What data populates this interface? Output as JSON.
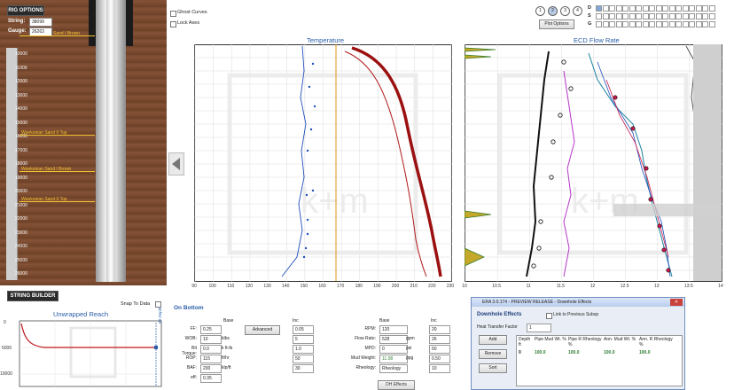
{
  "wellbore": {
    "rig_options": "RIG OPTIONS",
    "string_label": "String:",
    "string_value": "38099",
    "gauge_label": "Gauge:",
    "gauge_value": "26263",
    "depth_labels": [
      "10000",
      "11000",
      "12000",
      "13000",
      "14000",
      "15000",
      "16000",
      "17000",
      "18000",
      "19000",
      "20000",
      "21000",
      "22000",
      "23000",
      "24000",
      "25000",
      "26000"
    ],
    "formations": [
      "Sand I Brown",
      "Weekonian Sand II Top",
      "Weekonian Sand I Brown",
      "Weekonian Sand II Top"
    ],
    "string_builder": "STRING BUILDER",
    "snap_to_data": "Snap To Data"
  },
  "options": {
    "ghost_curves": "Ghost Curves",
    "lock_axes": "Lock Axes",
    "plot_numbers": [
      "1",
      "2",
      "3",
      "4"
    ],
    "plot_options": "Plot Options",
    "dsg": [
      "D",
      "S",
      "G"
    ]
  },
  "temperature_plot": {
    "title": "Temperature",
    "x_ticks": [
      "90",
      "100",
      "110",
      "120",
      "130",
      "140",
      "150",
      "160",
      "170",
      "180",
      "190",
      "200",
      "210",
      "220",
      "230"
    ],
    "watermark": "k+m"
  },
  "ecd_plot": {
    "title": "ECD Flow Rate",
    "x_ticks": [
      "10",
      "10.5",
      "11",
      "11.5",
      "12",
      "12.5",
      "13",
      "13.5",
      "14"
    ],
    "watermark": "k+m"
  },
  "reach": {
    "title": "Unwrapped Reach",
    "y_ticks": [
      "0",
      "5000",
      "10000"
    ],
    "bit_depth": "Bit Depth",
    "watermark": "k+m"
  },
  "on_bottom": {
    "title": "On Bottom",
    "base_label": "Base",
    "inc_label": "Inc",
    "advanced": "Advanced",
    "left_rows": [
      {
        "label": "FF:",
        "base": "0.25",
        "inc": "0.05",
        "unit": ""
      },
      {
        "label": "WOB:",
        "base": "10",
        "inc": "5",
        "unit": "klbs"
      },
      {
        "label": "Bit Torque:",
        "base": "0.0",
        "inc": "1.0",
        "unit": "k ft-lb"
      },
      {
        "label": "ROP:",
        "base": "115",
        "inc": "50",
        "unit": "ft/hr"
      },
      {
        "label": "BAF:",
        "base": "200",
        "inc": "30",
        "unit": "klp/ft"
      },
      {
        "label": "eff:",
        "base": "0.35",
        "inc": "",
        "unit": ""
      }
    ],
    "right_rows": [
      {
        "label": "RPM:",
        "base": "120",
        "inc": "20",
        "unit": ""
      },
      {
        "label": "Flow Rate:",
        "base": "528",
        "inc": "26",
        "unit": "gpm"
      },
      {
        "label": "MPD:",
        "base": "0",
        "inc": "50",
        "unit": "psi"
      },
      {
        "label": "Mud Weight:",
        "base": "11.08",
        "inc": "0.50",
        "unit": "ppg"
      },
      {
        "label": "Rheology:",
        "base": "Rheology",
        "inc": "10",
        "unit": ""
      }
    ],
    "dh_effects": "DH Effects"
  },
  "dialog": {
    "title": "ERA 3.0.174 - PREVIEW RELEASE - Downhole Effects",
    "heading": "Downhole Effects",
    "link_subsea": "Link to Previous Subsp",
    "htf_label": "Heat Transfer Factor",
    "htf_value": "1",
    "add": "Add",
    "remove": "Remove",
    "sort": "Sort",
    "columns": [
      "Depth ft",
      "Pipe Mud Wt. %",
      "Pipe R Rheology %",
      "Ann. Mud Wt. %",
      "Ann. R Rheology %"
    ],
    "row": [
      "0",
      "100.0",
      "100.0",
      "100.0",
      "100.0"
    ]
  }
}
